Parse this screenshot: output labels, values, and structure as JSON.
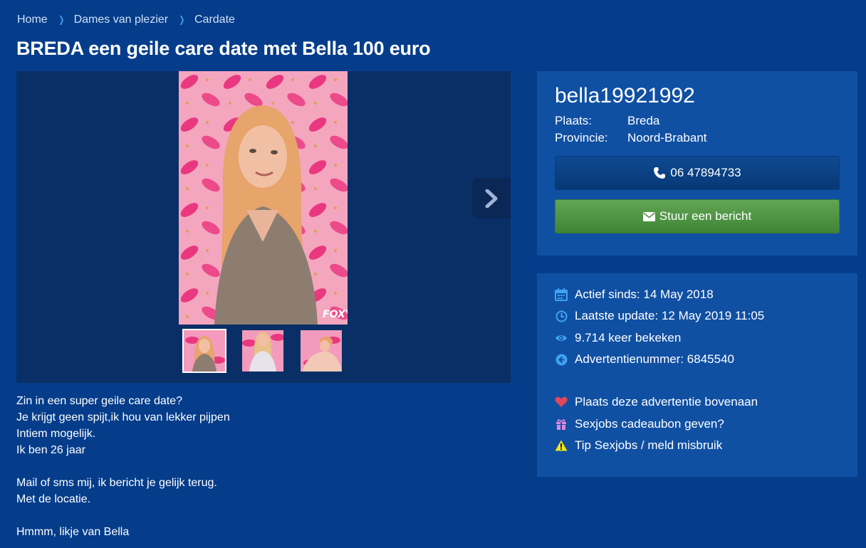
{
  "breadcrumb": {
    "items": [
      "Home",
      "Dames van plezier",
      "Cardate"
    ]
  },
  "page_title": "BREDA een geile care date met Bella 100 euro",
  "gallery": {
    "watermark": "FOXY",
    "thumb_count": 3,
    "active_thumb": 0
  },
  "description": {
    "lines": [
      "Zin in een super geile care date?",
      "Je krijgt geen spijt,ik hou van lekker pijpen",
      "Intiem mogelijk.",
      "Ik ben 26 jaar",
      "",
      "Mail of sms mij, ik bericht je gelijk terug.",
      "Met de locatie.",
      "",
      "Hmmm, likje van Bella"
    ]
  },
  "profile": {
    "username": "bella19921992",
    "place_label": "Plaats:",
    "place_value": "Breda",
    "province_label": "Provincie:",
    "province_value": "Noord-Brabant",
    "phone": "06 47894733",
    "message_label": "Stuur een bericht"
  },
  "stats": {
    "active_since": "Actief sinds: 14 May 2018",
    "last_update": "Laatste update: 12 May 2019 11:05",
    "views": "9.714 keer bekeken",
    "ad_number": "Advertentienummer: 6845540"
  },
  "actions": {
    "promote": "Plaats deze advertentie bovenaan",
    "gift": "Sexjobs cadeaubon geven?",
    "report": "Tip Sexjobs / meld misbruik"
  },
  "colors": {
    "background": "#053d8b",
    "card": "#1050a3",
    "accent_icon": "#3fa3f2",
    "message_button": "#4f9545",
    "heart": "#e0475a",
    "gift": "#d98be0",
    "warning": "#f2e21a"
  }
}
